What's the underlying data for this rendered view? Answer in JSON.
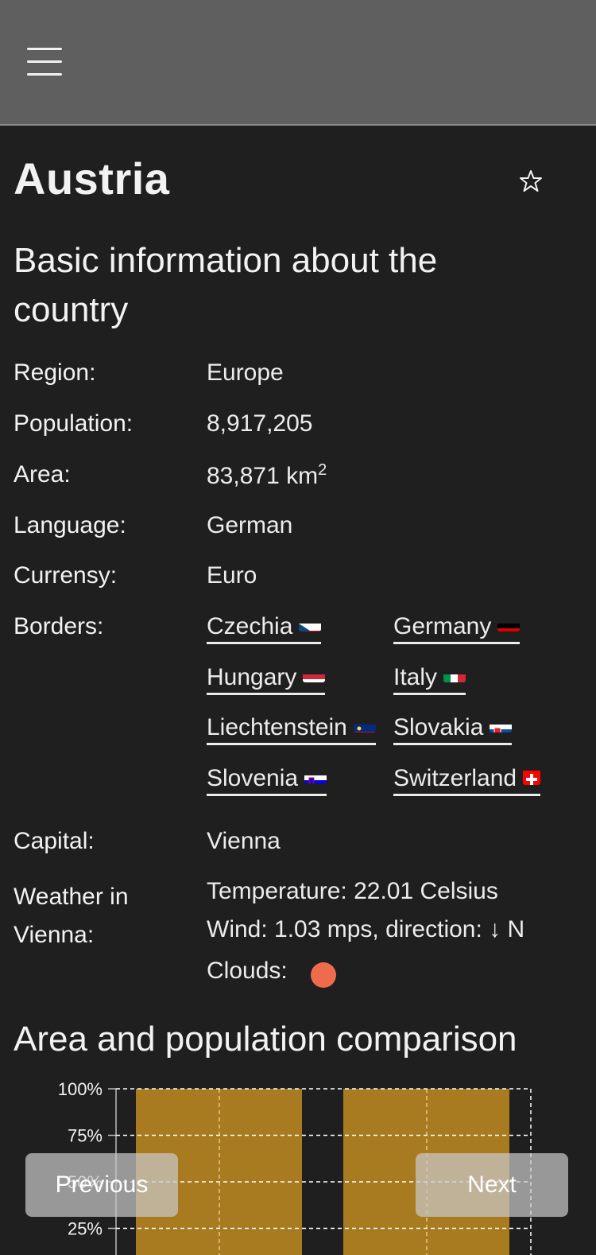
{
  "header": {
    "menu_icon": "hamburger-icon"
  },
  "country": {
    "name": "Austria",
    "favorite_icon": "star-icon"
  },
  "basic_info": {
    "heading_line1": "Basic information about the",
    "heading_line2": "country",
    "rows": {
      "region": {
        "label": "Region:",
        "value": "Europe"
      },
      "population": {
        "label": "Population:",
        "value": "8,917,205"
      },
      "area": {
        "label": "Area:",
        "value": "83,871 km",
        "unit_sup": "2"
      },
      "language": {
        "label": "Language:",
        "value": "German"
      },
      "currency": {
        "label": "Currensy:",
        "value": "Euro"
      },
      "borders": {
        "label": "Borders:"
      },
      "capital": {
        "label": "Capital:",
        "value": "Vienna"
      }
    },
    "borders": [
      {
        "name": "Czechia",
        "flag": "czechia-flag"
      },
      {
        "name": "Germany",
        "flag": "germany-flag"
      },
      {
        "name": "Hungary",
        "flag": "hungary-flag"
      },
      {
        "name": "Italy",
        "flag": "italy-flag"
      },
      {
        "name": "Liechtenstein",
        "flag": "liechtenstein-flag"
      },
      {
        "name": "Slovakia",
        "flag": "slovakia-flag"
      },
      {
        "name": "Slovenia",
        "flag": "slovenia-flag"
      },
      {
        "name": "Switzerland",
        "flag": "switzerland-flag"
      }
    ],
    "weather": {
      "label_line1": "Weather in",
      "label_line2": "Vienna:",
      "temperature": "Temperature: 22.01 Celsius",
      "wind": "Wind: 1.03 mps, direction: ↓ N",
      "clouds_label": "Clouds:",
      "clouds_color": "#ee6c4d"
    }
  },
  "comparison": {
    "heading": "Area and population comparison"
  },
  "chart_data": {
    "type": "bar",
    "y_ticks": [
      "100%",
      "75%",
      "50%",
      "25%"
    ],
    "ylim": [
      0,
      100
    ],
    "values": [
      100,
      100
    ],
    "bar_color": "#a87b21",
    "grid": true
  },
  "navigation": {
    "previous_label": "Previous",
    "next_label": "Next"
  }
}
